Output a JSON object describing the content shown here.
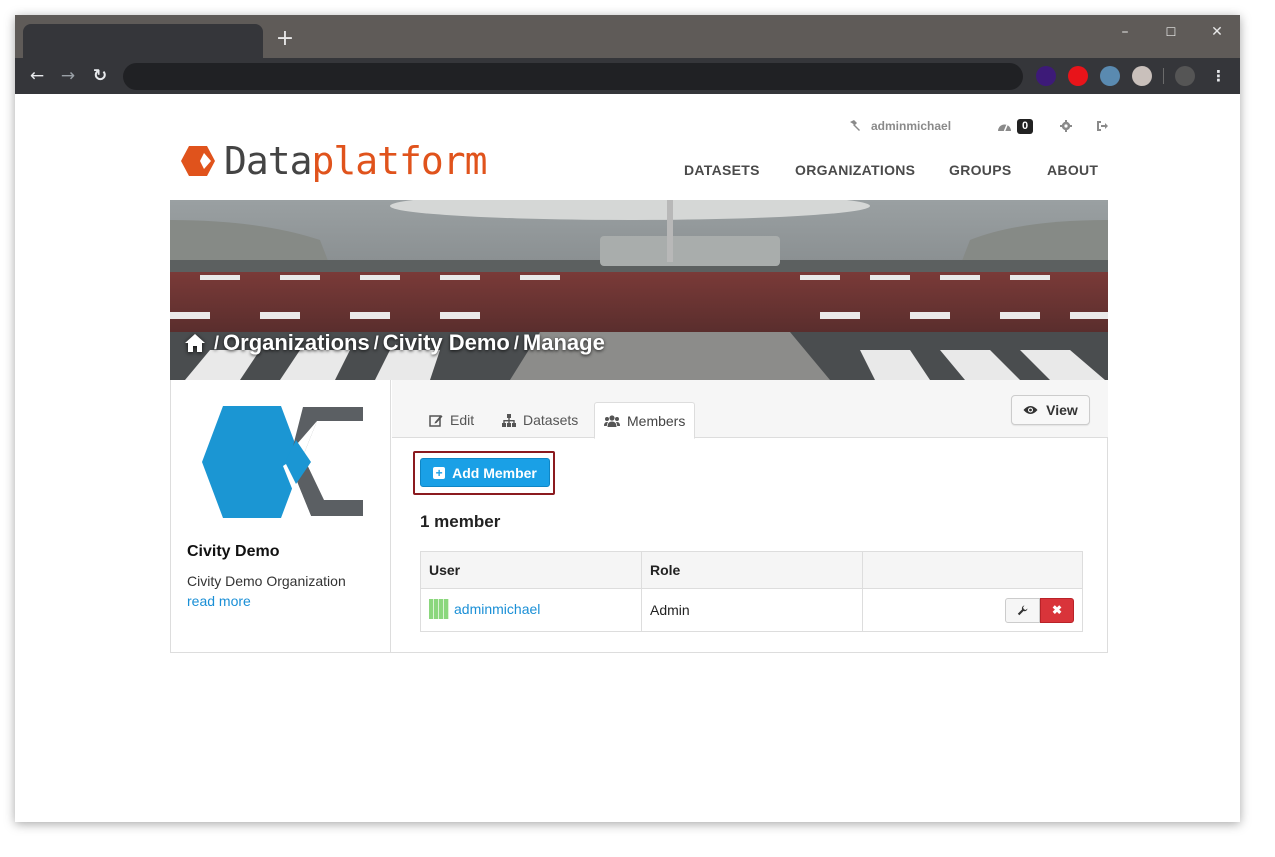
{
  "browser": {
    "new_tab_glyph": "+",
    "window_controls": {
      "minimize": "–",
      "maximize": "☐",
      "close": "✕"
    },
    "nav": {
      "back": "←",
      "forward": "→",
      "reload": "↻"
    },
    "extension_colors": [
      "#3d1a78",
      "#e8141a",
      "#5a8ab0",
      "#c9c0bb",
      "#555555"
    ],
    "menu_glyph": "⋮"
  },
  "account": {
    "username": "adminmichael",
    "dashboard_count": "0",
    "icons": {
      "user": "hammer-icon",
      "dashboard": "dashboard-icon",
      "settings": "gear-icon",
      "logout": "sign-out-icon"
    }
  },
  "site": {
    "logo_part1": "Data",
    "logo_part2": "platform",
    "brand_color": "#e0531c"
  },
  "main_nav": [
    "DATASETS",
    "ORGANIZATIONS",
    "GROUPS",
    "ABOUT"
  ],
  "breadcrumb": {
    "home_icon": "home-icon",
    "items": [
      "Organizations",
      "Civity Demo",
      "Manage"
    ],
    "separator": "/"
  },
  "organization": {
    "title": "Civity Demo",
    "description": "Civity Demo Organization",
    "read_more": "read more"
  },
  "tabs": [
    {
      "label": "Edit",
      "icon": "edit-icon"
    },
    {
      "label": "Datasets",
      "icon": "sitemap-icon"
    },
    {
      "label": "Members",
      "icon": "group-icon",
      "active": true
    }
  ],
  "view_button": "View",
  "add_member_button": "Add Member",
  "member_count": "1 member",
  "table": {
    "headers": [
      "User",
      "Role",
      ""
    ],
    "rows": [
      {
        "user": "adminmichael",
        "role": "Admin"
      }
    ]
  },
  "colors": {
    "accent": "#1aa0e6",
    "danger": "#d9343a",
    "link": "#1a8fd6",
    "highlight_border": "#8b1a1f"
  }
}
